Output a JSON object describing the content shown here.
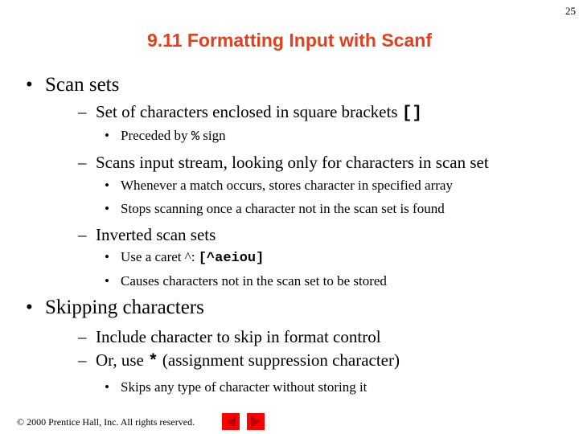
{
  "page_number": "25",
  "title": "9.11  Formatting Input with Scanf",
  "bullets": {
    "scan_sets": "Scan sets",
    "set_of_chars": "Set of characters enclosed in square brackets ",
    "brackets_code": "[]",
    "preceded_pre": "Preceded by ",
    "percent_code": "%",
    "preceded_post": " sign",
    "scans_input": "Scans input stream, looking only for characters in scan set",
    "whenever": "Whenever a match occurs, stores character in specified array",
    "stops": "Stops scanning once a character not in the scan set is found",
    "inverted": "Inverted scan sets",
    "caret_pre": "Use a caret ^: ",
    "caret_code": "[^aeiou]",
    "causes": "Causes characters not in the scan set to be stored",
    "skipping": "Skipping characters",
    "include": "Include character to skip in format control",
    "or_use_pre": "Or, use ",
    "star_code": "*",
    "or_use_post": " (assignment suppression character)",
    "skips_any": "Skips any type of character without storing it"
  },
  "markers": {
    "bullet": "•",
    "dash": "–"
  },
  "footer": {
    "copyright": "© 2000 Prentice Hall, Inc.  All rights reserved.",
    "prev_icon": "previous-slide-arrow",
    "next_icon": "next-slide-arrow",
    "nav_color": "#ff0000",
    "arrow_color": "#c00000"
  }
}
